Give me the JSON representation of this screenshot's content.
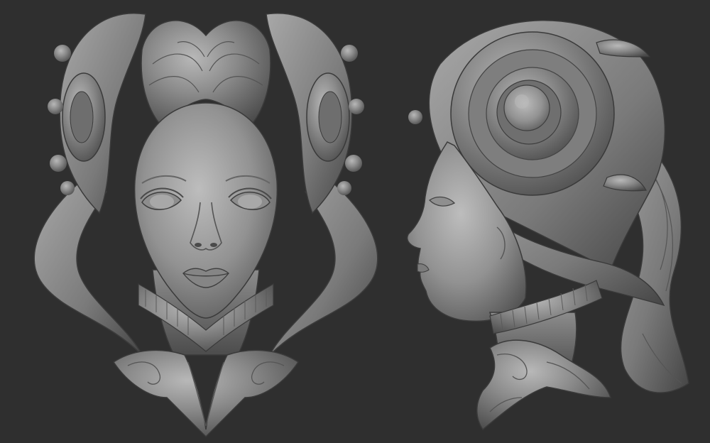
{
  "scene": {
    "background_color": "#2f2f2f",
    "material_color": "#7c7c7c",
    "highlight_color": "#b4b4b4",
    "shadow_color": "#3a3a3a",
    "views": [
      {
        "id": "front",
        "subject": "sculpted-head-front-view"
      },
      {
        "id": "profile",
        "subject": "sculpted-head-profile-view"
      }
    ]
  }
}
